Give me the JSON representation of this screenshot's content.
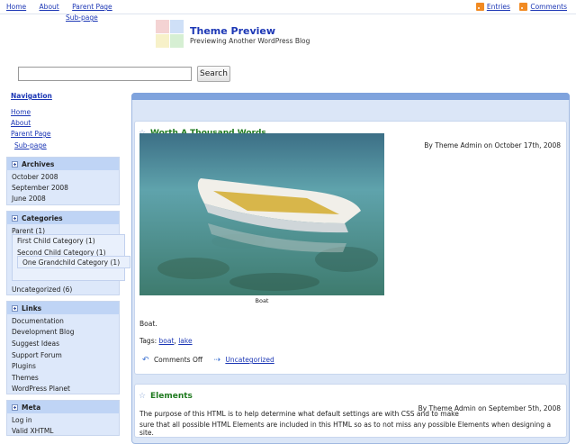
{
  "topnav": {
    "items": [
      "Home",
      "About",
      "Parent Page"
    ],
    "subpage": "Sub-page",
    "feeds": [
      "Entries",
      "Comments"
    ]
  },
  "header": {
    "title": "Theme Preview",
    "description": "Previewing Another WordPress Blog",
    "logo_colors": [
      "#f4d3d3",
      "#cfe0f7",
      "#f7f1c9",
      "#d6efd3"
    ]
  },
  "search": {
    "placeholder": "",
    "value": "",
    "button": "Search"
  },
  "sidebar": {
    "navigation": {
      "heading": "Navigation",
      "items": [
        "Home",
        "About",
        "Parent Page",
        "Sub-page"
      ]
    },
    "archives": {
      "heading": "Archives",
      "items": [
        "October 2008",
        "September 2008",
        "June 2008"
      ]
    },
    "categories": {
      "heading": "Categories",
      "parent": "Parent (1)",
      "first_child": "First Child Category (1)",
      "second_child": "Second Child Category (1)",
      "grandchild": "One Grandchild Category (1)",
      "uncategorized": "Uncategorized (6)"
    },
    "links": {
      "heading": "Links",
      "items": [
        "Documentation",
        "Development Blog",
        "Suggest Ideas",
        "Support Forum",
        "Plugins",
        "Themes",
        "WordPress Planet"
      ]
    },
    "meta": {
      "heading": "Meta",
      "items": [
        "Log in",
        "Valid XHTML"
      ]
    }
  },
  "posts": [
    {
      "title": "Worth A Thousand Words",
      "meta": "By Theme Admin on October 17th, 2008",
      "caption": "Boat",
      "body": "Boat.",
      "tags_label": "Tags:",
      "tags": [
        "boat",
        "lake"
      ],
      "comments": "Comments Off",
      "category": "Uncategorized"
    },
    {
      "title": "Elements",
      "meta": "By Theme Admin on September 5th, 2008",
      "body_line1": "The purpose of this HTML is to help determine what default settings are with CSS  and to make",
      "body_line2": "sure that all possible HTML Elements are included in this HTML so as to not miss any possible Elements when designing a site."
    }
  ],
  "colors": {
    "link": "#1c37b5",
    "post_title": "#1f7a1f",
    "widget_bg": "#dde8fa",
    "widget_head": "#bfd4f5",
    "main_bg": "#dbe6f7"
  }
}
